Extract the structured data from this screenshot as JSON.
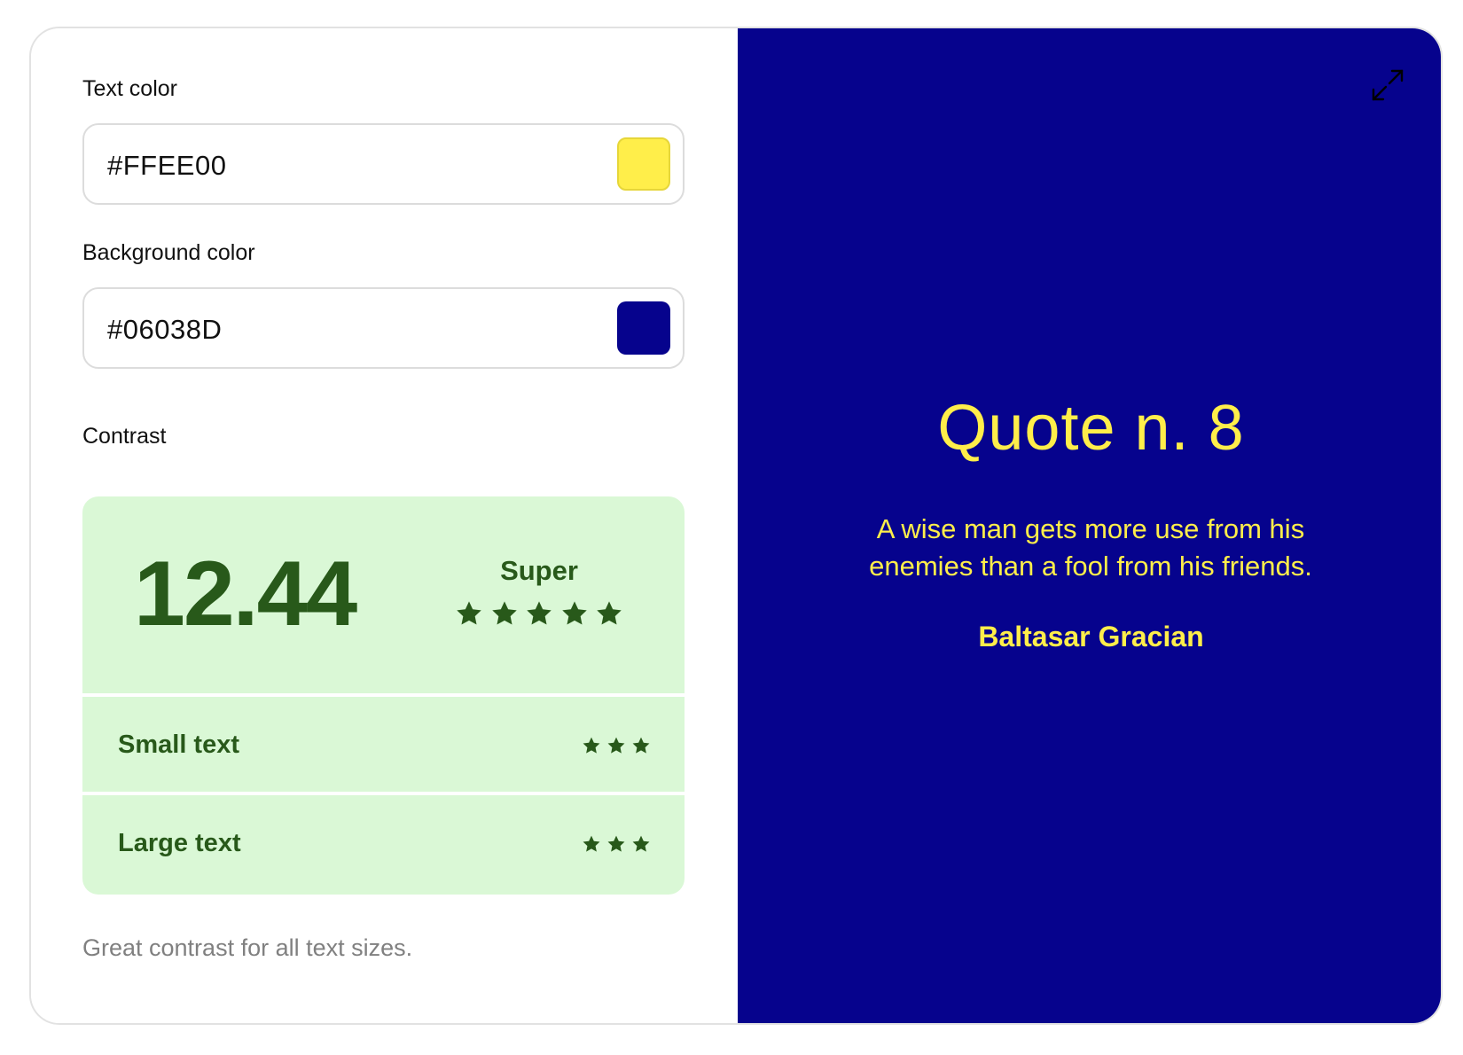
{
  "text_color": {
    "label": "Text color",
    "value": "#FFEE00",
    "swatch_color": "#FFEE4A"
  },
  "background_color": {
    "label": "Background color",
    "value": "#06038D",
    "swatch_color": "#06038D"
  },
  "contrast": {
    "label": "Contrast",
    "score": "12.44",
    "rating": "Super",
    "rating_stars": 5,
    "small_text": {
      "label": "Small text",
      "stars": 3
    },
    "large_text": {
      "label": "Large text",
      "stars": 3
    },
    "helper_text": "Great contrast for all text sizes.",
    "box_color": "#DAF8D6",
    "accent_color": "#28591A"
  },
  "preview": {
    "title": "Quote n. 8",
    "quote": "A wise man gets more use from his enemies than a fool from his friends.",
    "author": "Baltasar Gracian",
    "background": "#06038D",
    "text_color": "#FFEE4A",
    "expand_icon": "expand-icon"
  }
}
